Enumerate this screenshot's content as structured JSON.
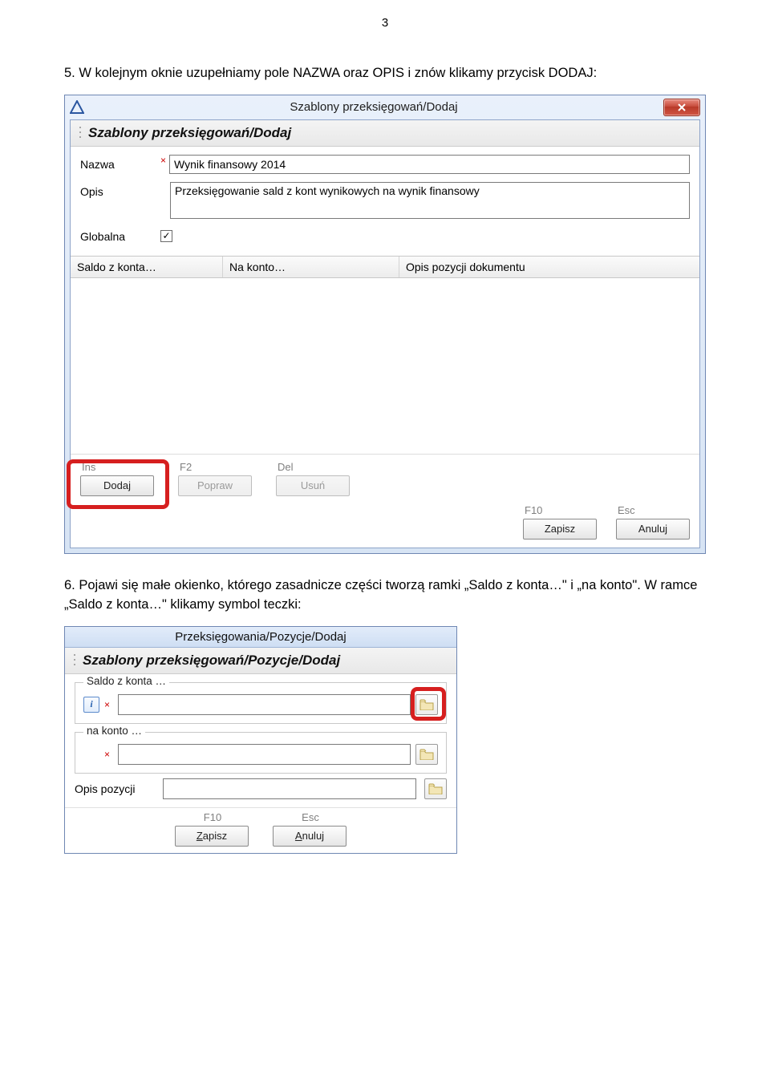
{
  "page_number": "3",
  "step5_text": "5.  W kolejnym oknie uzupełniamy pole NAZWA oraz OPIS i znów klikamy przycisk DODAJ:",
  "step6_text": "6.  Pojawi się małe okienko, którego zasadnicze części tworzą ramki „Saldo z konta…\" i „na konto\". W ramce „Saldo z konta…\" klikamy symbol teczki:",
  "win1": {
    "title": "Szablony przeksięgowań/Dodaj",
    "header": "Szablony przeksięgowań/Dodaj",
    "labels": {
      "nazwa": "Nazwa",
      "opis": "Opis",
      "globalna": "Globalna"
    },
    "values": {
      "nazwa": "Wynik finansowy 2014",
      "opis": "Przeksięgowanie sald z kont wynikowych na wynik finansowy"
    },
    "globalna_checked": true,
    "columns": {
      "saldo": "Saldo z konta…",
      "nakonto": "Na konto…",
      "opis": "Opis pozycji dokumentu"
    },
    "btns": {
      "ins_hint": "Ins",
      "dodaj": "Dodaj",
      "f2_hint": "F2",
      "popraw": "Popraw",
      "del_hint": "Del",
      "usun": "Usuń",
      "f10_hint": "F10",
      "zapisz": "Zapisz",
      "esc_hint": "Esc",
      "anuluj": "Anuluj"
    }
  },
  "win2": {
    "title": "Przeksięgowania/Pozycje/Dodaj",
    "header": "Szablony przeksięgowań/Pozycje/Dodaj",
    "group1_legend": "Saldo z konta …",
    "group2_legend": "na konto …",
    "opis_label": "Opis pozycji",
    "btns": {
      "f10_hint": "F10",
      "esc_hint": "Esc",
      "zapisz_main": "apisz",
      "zapisz_ul": "Z",
      "anuluj_main": "nuluj",
      "anuluj_ul": "A"
    }
  }
}
